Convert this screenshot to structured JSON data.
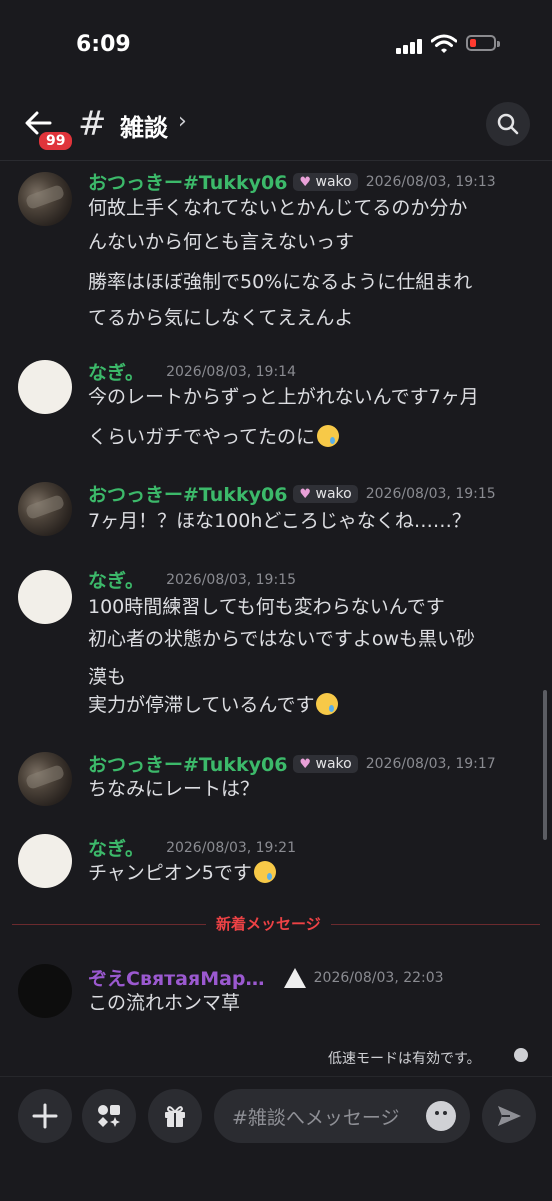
{
  "status": {
    "time": "6:09"
  },
  "header": {
    "unread_badge": "99",
    "hash": "#",
    "channel_name": "雑談",
    "chevron": "›"
  },
  "messages": [
    {
      "author": "おつっきー#Tukky06",
      "tag": "wako",
      "timestamp": "2026/08/03, 19:13",
      "lines": [
        "何故上手くなれてないとかんじてるのか分か",
        "んないから何とも言えないっす",
        "勝率はほぼ強制で50%になるように仕組まれ",
        "てるから気にしなくてええんよ"
      ]
    },
    {
      "author": "なぎ。",
      "timestamp": "2026/08/03, 19:14",
      "lines": [
        "今のレートからずっと上がれないんです7ヶ月",
        "くらいガチでやってたのに"
      ]
    },
    {
      "author": "おつっきー#Tukky06",
      "tag": "wako",
      "timestamp": "2026/08/03, 19:15",
      "lines": [
        "7ヶ月！？ほな100hどころじゃなくね……？"
      ]
    },
    {
      "author": "なぎ。",
      "timestamp": "2026/08/03, 19:15",
      "lines": [
        "100時間練習しても何も変わらないんです",
        "初心者の状態からではないですよowも黒い砂",
        "漠も",
        "実力が停滞しているんです"
      ]
    },
    {
      "author": "おつっきー#Tukky06",
      "tag": "wako",
      "timestamp": "2026/08/03, 19:17",
      "lines": [
        "ちなみにレートは？"
      ]
    },
    {
      "author": "なぎ。",
      "timestamp": "2026/08/03, 19:21",
      "lines": [
        "チャンピオン5です"
      ]
    },
    {
      "author": "ぞえСвятаяМар…",
      "timestamp": "2026/08/03, 22:03",
      "lines": [
        "この流れホンマ草"
      ]
    }
  ],
  "new_messages_label": "新着メッセージ",
  "slowmode_text": "低速モードは有効です。",
  "composer": {
    "placeholder": "#雑談へメッセージ"
  },
  "colors": {
    "green_name": "#3cb96a",
    "purple_name": "#9b59d0",
    "new_divider": "#ed4245"
  },
  "icons": [
    "back-arrow-icon",
    "search-icon",
    "plus-icon",
    "apps-icon",
    "gift-icon",
    "emoji-icon",
    "send-icon",
    "timer-icon",
    "rice-ball-icon",
    "crying-face-emoji"
  ]
}
